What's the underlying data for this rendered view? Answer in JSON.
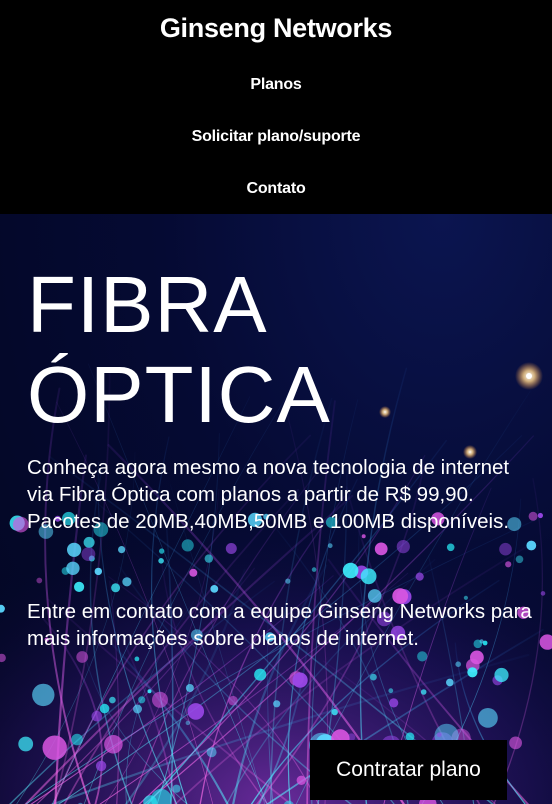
{
  "header": {
    "brand": "Ginseng Networks",
    "nav": [
      {
        "label": "Planos"
      },
      {
        "label": "Solicitar plano/suporte"
      },
      {
        "label": "Contato"
      }
    ]
  },
  "hero": {
    "title_line1": "FIBRA",
    "title_line2": "ÓPTICA",
    "paragraph1": "Conheça agora mesmo a nova tecnologia de internet via Fibra Óptica com planos a partir de R$ 99,90. Pacotes de 20MB,40MB,50MB e 100MB disponíveis.",
    "paragraph2": "Entre em contato com a equipe Ginseng Networks para mais informações sobre planos de internet.",
    "cta_label": "Contratar plano",
    "background_image": "fiber-optic-strands-image"
  },
  "colors": {
    "header_bg": "#000000",
    "hero_bg": "#050a33",
    "fiber_cyan": "#22e5f0",
    "fiber_pink": "#d455d8",
    "fiber_purple": "#7a3be0",
    "text": "#ffffff"
  }
}
